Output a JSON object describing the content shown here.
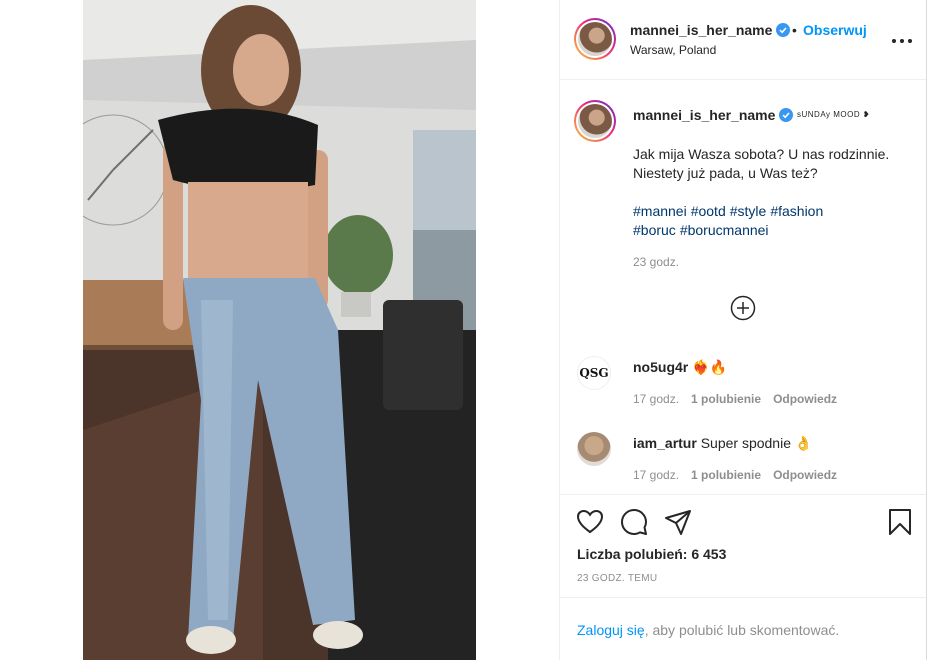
{
  "post": {
    "username": "mannei_is_her_name",
    "follow_label": "Obserwuj",
    "dot": "•",
    "location": "Warsaw, Poland",
    "caption_mood": "sUNDAy MOOD",
    "caption_text": "Jak mija Wasza sobota? U nas rodzinnie. Niestety już pada, u Was też?",
    "hashtags": [
      "#mannei",
      "#ootd",
      "#style",
      "#fashion",
      "#boruc",
      "#borucmannei"
    ],
    "caption_time": "23 godz."
  },
  "comments": [
    {
      "username": "no5ug4r",
      "text": "",
      "emoji": "❤️‍🔥🔥",
      "avatar_text": "QSG",
      "time": "17 godz.",
      "likes": "1 polubienie",
      "reply": "Odpowiedz"
    },
    {
      "username": "iam_artur",
      "text": "Super spodnie",
      "emoji": "👌",
      "avatar_text": "",
      "time": "17 godz.",
      "likes": "1 polubienie",
      "reply": "Odpowiedz"
    }
  ],
  "stats": {
    "likes_label": "Liczba polubień: 6 453",
    "time_ago": "23 GODZ. TEMU"
  },
  "login": {
    "link": "Zaloguj się",
    "rest": ", aby polubić lub skomentować."
  },
  "icons": {
    "verified": "verified-badge-icon",
    "more": "more-options-icon",
    "like": "heart-icon",
    "comment": "comment-icon",
    "share": "share-icon",
    "save": "bookmark-icon",
    "load_more": "plus-circle-icon"
  },
  "colors": {
    "link": "#0095f6",
    "hashtag": "#00376b",
    "muted": "#8e8e8e",
    "text": "#262626"
  }
}
